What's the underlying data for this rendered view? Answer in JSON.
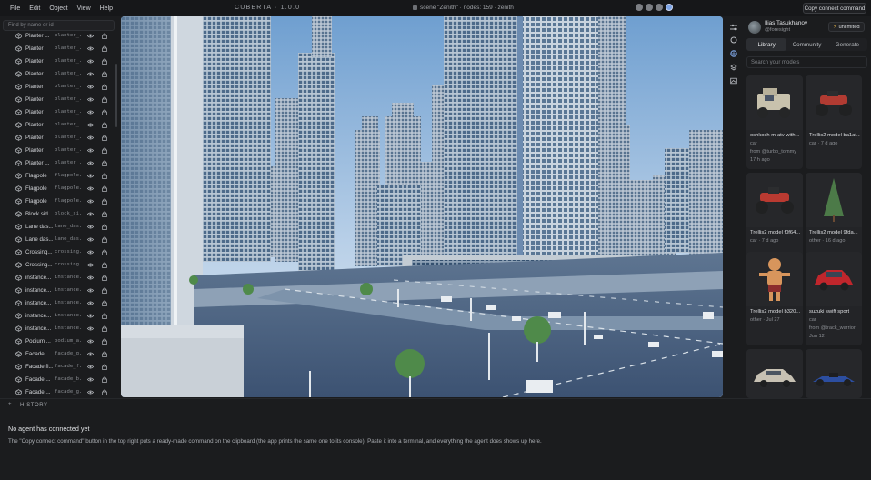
{
  "menu": [
    "File",
    "Edit",
    "Object",
    "View",
    "Help"
  ],
  "app_title": "CUBERTA · 1.0.0",
  "scene_info": "scene \"Zenith\" · nodes: 159 · zenith",
  "copy_button": "Copy connect command",
  "outline": {
    "search_placeholder": "Find by name or id",
    "rows": [
      {
        "name": "Planter ...",
        "id": "planter_..."
      },
      {
        "name": "Planter",
        "id": "planter_..."
      },
      {
        "name": "Planter",
        "id": "planter_..."
      },
      {
        "name": "Planter",
        "id": "planter_..."
      },
      {
        "name": "Planter",
        "id": "planter_..."
      },
      {
        "name": "Planter",
        "id": "planter_..."
      },
      {
        "name": "Planter",
        "id": "planter_..."
      },
      {
        "name": "Planter",
        "id": "planter_..."
      },
      {
        "name": "Planter",
        "id": "planter_..."
      },
      {
        "name": "Planter",
        "id": "planter_..."
      },
      {
        "name": "Planter ...",
        "id": "planter_..."
      },
      {
        "name": "Flagpole",
        "id": "flagpole..."
      },
      {
        "name": "Flagpole",
        "id": "flagpole..."
      },
      {
        "name": "Flagpole",
        "id": "flagpole..."
      },
      {
        "name": "Block sid...",
        "id": "block_si..."
      },
      {
        "name": "Lane das...",
        "id": "lane_das..."
      },
      {
        "name": "Lane das...",
        "id": "lane_das..."
      },
      {
        "name": "Crossing...",
        "id": "crossing..."
      },
      {
        "name": "Crossing...",
        "id": "crossing..."
      },
      {
        "name": "instance...",
        "id": "instance..."
      },
      {
        "name": "instance...",
        "id": "instance..."
      },
      {
        "name": "instance...",
        "id": "instance..."
      },
      {
        "name": "instance...",
        "id": "instance..."
      },
      {
        "name": "instance...",
        "id": "instance..."
      },
      {
        "name": "Podium ...",
        "id": "podium_a..."
      },
      {
        "name": "Facade ...",
        "id": "facade_g..."
      },
      {
        "name": "Facade fi...",
        "id": "facade_f..."
      },
      {
        "name": "Facade ...",
        "id": "facade_b..."
      },
      {
        "name": "Facade ...",
        "id": "facade_g..."
      }
    ]
  },
  "user": {
    "name": "Ilias Tasukhanov",
    "handle": "@foresight",
    "plan": "unlimited"
  },
  "tabs": [
    "Library",
    "Community",
    "Generate"
  ],
  "library_search_placeholder": "Search your models",
  "models": [
    {
      "title": "oshkosh m-atv with...",
      "category": "car",
      "from": "from @turbo_tommy",
      "ago": "17 h ago"
    },
    {
      "title": "Trellis2 model ba1af...",
      "category": "car · 7 d ago",
      "from": "",
      "ago": ""
    },
    {
      "title": "Trellis2 model f0f64...",
      "category": "car · 7 d ago",
      "from": "",
      "ago": ""
    },
    {
      "title": "Trellis2 model 9fda...",
      "category": "other · 16 d ago",
      "from": "",
      "ago": ""
    },
    {
      "title": "Trellis2 model b320...",
      "category": "other · Jul 27",
      "from": "",
      "ago": ""
    },
    {
      "title": "suzuki swift sport",
      "category": "car",
      "from": "from @track_warrior",
      "ago": "Jun 12"
    },
    {
      "title": "",
      "category": "",
      "from": "",
      "ago": ""
    },
    {
      "title": "",
      "category": "",
      "from": "",
      "ago": ""
    }
  ],
  "history_label": "HISTORY",
  "agent": {
    "title": "No agent has connected yet",
    "text": "The \"Copy connect command\" button in the top right puts a ready-made command on the clipboard (the app prints the same one to its console). Paste it into a terminal, and everything the agent does shows up here."
  },
  "colors": {
    "accent": "#7fa6e6",
    "plan_bolt": "#e6b64a",
    "background": "#1b1c1e"
  }
}
